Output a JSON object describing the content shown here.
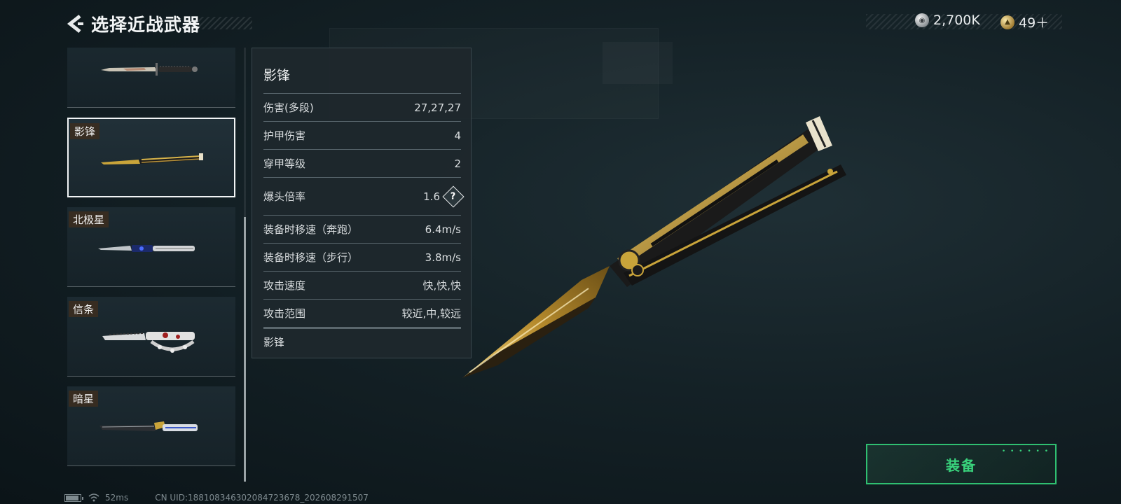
{
  "header": {
    "title": "选择近战武器",
    "back_icon": "chevron-left-icon"
  },
  "currency": [
    {
      "icon": "silver-coin-icon",
      "value": "2,700K"
    },
    {
      "icon": "gold-coin-icon",
      "value": "49＋"
    }
  ],
  "weapons": [
    {
      "label": "",
      "selected": false
    },
    {
      "label": "影锋",
      "selected": true
    },
    {
      "label": "北极星",
      "selected": false
    },
    {
      "label": "信条",
      "selected": false
    },
    {
      "label": "暗星",
      "selected": false
    }
  ],
  "stats": {
    "title": "影锋",
    "rows": [
      {
        "name": "伤害(多段)",
        "value": "27,27,27"
      },
      {
        "name": "护甲伤害",
        "value": "4"
      },
      {
        "name": "穿甲等级",
        "value": "2"
      },
      {
        "name": "爆头倍率",
        "value": "1.6",
        "help": "?"
      },
      {
        "name": "装备时移速（奔跑）",
        "value": "6.4m/s"
      },
      {
        "name": "装备时移速（步行）",
        "value": "3.8m/s"
      },
      {
        "name": "攻击速度",
        "value": "快,快,快"
      },
      {
        "name": "攻击范围",
        "value": "较近,中,较远"
      }
    ],
    "footer": "影锋"
  },
  "equip_button": {
    "label": "装备"
  },
  "status": {
    "ping": "52ms",
    "uid": "CN UID:18810834630208472367​8_202608291507"
  },
  "colors": {
    "accent": "#39d27c",
    "selected_border": "#f1f4f5"
  }
}
